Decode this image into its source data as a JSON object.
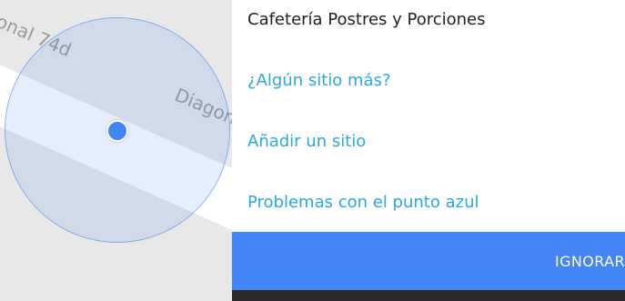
{
  "map": {
    "road_label_1": "gonal 74d",
    "road_label_2": "Diagon"
  },
  "panel": {
    "title": "Cafetería Postres y Porciones",
    "items": [
      {
        "label": "¿Algún sitio más?"
      },
      {
        "label": "Añadir un sitio"
      },
      {
        "label": "Problemas con el punto azul"
      }
    ],
    "ignore_label": "IGNORAR"
  },
  "colors": {
    "accent": "#4385f4",
    "link": "#2ba8e0",
    "location_dot": "#4285f4"
  },
  "icons": [
    "location-dot-icon"
  ]
}
